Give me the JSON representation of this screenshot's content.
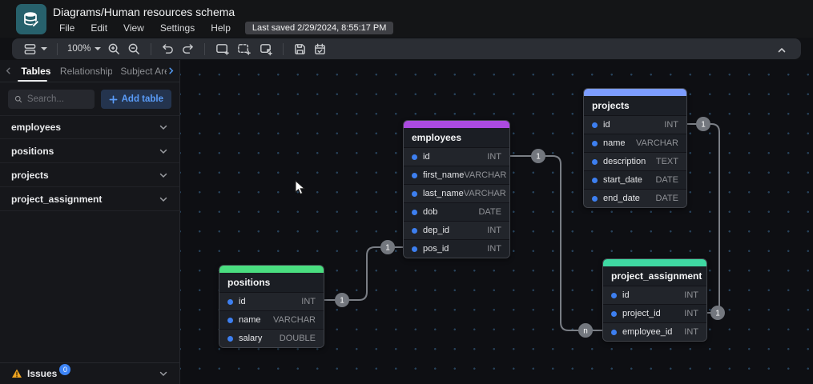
{
  "header": {
    "title": "Diagrams/Human resources schema",
    "menu": [
      "File",
      "Edit",
      "View",
      "Settings",
      "Help"
    ],
    "last_saved": "Last saved 2/29/2024, 8:55:17 PM"
  },
  "toolbar": {
    "zoom_level": "100%"
  },
  "sidebar": {
    "tabs": [
      "Tables",
      "Relationships",
      "Subject Are"
    ],
    "active_tab": "Tables",
    "search_placeholder": "Search...",
    "add_table_label": "Add table",
    "tables": [
      "employees",
      "positions",
      "projects",
      "project_assignment"
    ],
    "issues": {
      "label": "Issues",
      "count": "0"
    }
  },
  "canvas": {
    "tables": [
      {
        "name": "employees",
        "color": "#ab4be0",
        "fields": [
          {
            "name": "id",
            "type": "INT"
          },
          {
            "name": "first_name",
            "type": "VARCHAR"
          },
          {
            "name": "last_name",
            "type": "VARCHAR"
          },
          {
            "name": "dob",
            "type": "DATE"
          },
          {
            "name": "dep_id",
            "type": "INT"
          },
          {
            "name": "pos_id",
            "type": "INT"
          }
        ]
      },
      {
        "name": "positions",
        "color": "#4ade80",
        "fields": [
          {
            "name": "id",
            "type": "INT"
          },
          {
            "name": "name",
            "type": "VARCHAR"
          },
          {
            "name": "salary",
            "type": "DOUBLE"
          }
        ]
      },
      {
        "name": "projects",
        "color": "#7d9dff",
        "fields": [
          {
            "name": "id",
            "type": "INT"
          },
          {
            "name": "name",
            "type": "VARCHAR"
          },
          {
            "name": "description",
            "type": "TEXT"
          },
          {
            "name": "start_date",
            "type": "DATE"
          },
          {
            "name": "end_date",
            "type": "DATE"
          }
        ]
      },
      {
        "name": "project_assignment",
        "color": "#3fd9a3",
        "fields": [
          {
            "name": "id",
            "type": "INT"
          },
          {
            "name": "project_id",
            "type": "INT"
          },
          {
            "name": "employee_id",
            "type": "INT"
          }
        ]
      }
    ],
    "relationships": [
      {
        "from": "positions.id",
        "to": "employees.pos_id",
        "start_label": "1",
        "end_label": "1"
      },
      {
        "from": "employees.id",
        "to": "project_assignment.employee_id",
        "start_label": "1",
        "end_label": "n"
      },
      {
        "from": "projects.id",
        "to": "project_assignment.project_id",
        "start_label": "1",
        "end_label": "1"
      }
    ]
  },
  "colors": {
    "accent_blue": "#539bf5",
    "warning": "#f0a421",
    "edge": "#7a7e85",
    "logo_bg": "#27616c"
  }
}
